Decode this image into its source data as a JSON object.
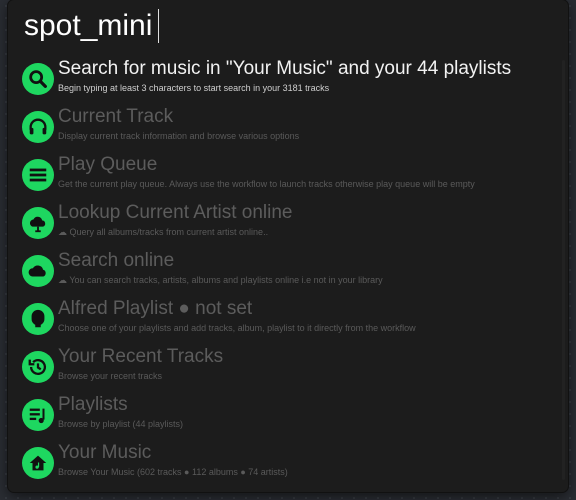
{
  "search": {
    "value": "spot_mini"
  },
  "colors": {
    "accent": "#1ed760",
    "background": "#1c1c1c",
    "selected_text": "#f2f2f2",
    "muted_text": "#5c5c5c"
  },
  "results": [
    {
      "title": "Search for music in \"Your Music\" and your 44 playlists",
      "subtitle": "Begin typing at least 3 characters to start search in your 3181 tracks",
      "icon": "search-icon",
      "selected": true
    },
    {
      "title": "Current Track",
      "subtitle": "Display current track information and browse various options",
      "icon": "headphones-icon"
    },
    {
      "title": "Play Queue",
      "subtitle": "Get the current play queue. Always use the workflow to launch tracks otherwise play queue will be empty",
      "icon": "queue-icon"
    },
    {
      "title": "Lookup Current Artist online",
      "subtitle": "☁ Query all albums/tracks from current artist online..",
      "icon": "cloud-artist-icon"
    },
    {
      "title": "Search online",
      "subtitle": "☁ You can search tracks, artists, albums and playlists online i.e not in your library",
      "icon": "cloud-icon"
    },
    {
      "title": "Alfred Playlist ● not set",
      "subtitle": "Choose one of your playlists and add tracks, album, playlist to it directly from the workflow",
      "icon": "alfred-playlist-icon"
    },
    {
      "title": "Your Recent Tracks",
      "subtitle": "Browse your recent tracks",
      "icon": "history-icon"
    },
    {
      "title": "Playlists",
      "subtitle": "Browse by playlist (44 playlists)",
      "icon": "playlist-icon"
    },
    {
      "title": "Your Music",
      "subtitle": "Browse Your Music (602 tracks ● 112  albums ● 74 artists)",
      "icon": "house-icon"
    }
  ]
}
